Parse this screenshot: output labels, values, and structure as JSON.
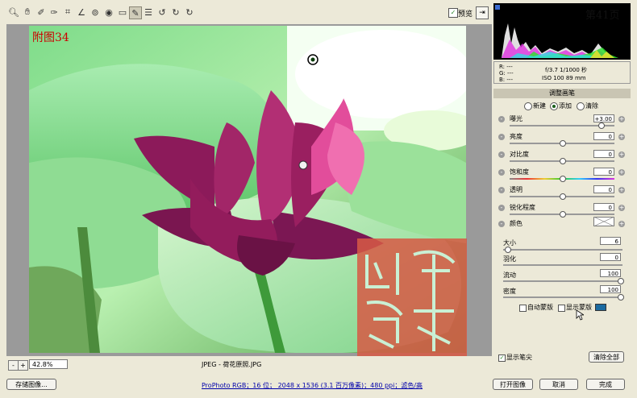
{
  "toolbar": {
    "tools": [
      "zoom-icon",
      "hand-icon",
      "white-balance-icon",
      "color-sampler-icon",
      "crop-icon",
      "straighten-icon",
      "retouch-icon",
      "red-eye-icon",
      "adjustment-brush-icon",
      "graduated-filter-icon",
      "preferences-icon",
      "rotate-ccw-icon",
      "rotate-cw-icon"
    ],
    "preview_label": "预览",
    "preview_checked": "✓"
  },
  "image": {
    "figure_label": "附图34",
    "filename": "JPEG - 荷花原照.JPG"
  },
  "zoom": {
    "minus": "-",
    "plus": "+",
    "value": "42.8%"
  },
  "page_number": "第41页",
  "info": {
    "r_label": "R:",
    "r_val": "---",
    "g_label": "G:",
    "g_val": "---",
    "b_label": "B:",
    "b_val": "---",
    "exif_line1": "f/3.7   1/1000 秒",
    "exif_line2": "ISO 100    89 mm"
  },
  "panel": {
    "title": "调整画笔",
    "mode_new": "新建",
    "mode_add": "添加",
    "mode_clear": "清除",
    "exposure_label": "曝光",
    "exposure_value": "+3.00",
    "brightness_label": "亮度",
    "brightness_value": "0",
    "contrast_label": "对比度",
    "contrast_value": "0",
    "saturation_label": "饱和度",
    "saturation_value": "0",
    "clarity_label": "透明",
    "clarity_value": "0",
    "sharpness_label": "锐化程度",
    "sharpness_value": "0",
    "color_label": "颜色",
    "size_label": "大小",
    "size_value": "6",
    "feather_label": "羽化",
    "feather_value": "0",
    "flow_label": "流动",
    "flow_value": "100",
    "density_label": "密度",
    "density_value": "100",
    "auto_mask_label": "自动蒙版",
    "show_mask_label": "显示蒙版",
    "mask_color": "#1a6aa0",
    "show_pins_label": "显示笔尖",
    "show_pins_checked": "✓",
    "clear_all": "清除全部"
  },
  "footer": {
    "save_image": "存储图像...",
    "status_link": "ProPhoto RGB；16 位； 2048 x 1536 (3.1 百万像素)；480 ppi；滤色/高",
    "open_image": "打开图像",
    "cancel": "取消",
    "done": "完成"
  }
}
